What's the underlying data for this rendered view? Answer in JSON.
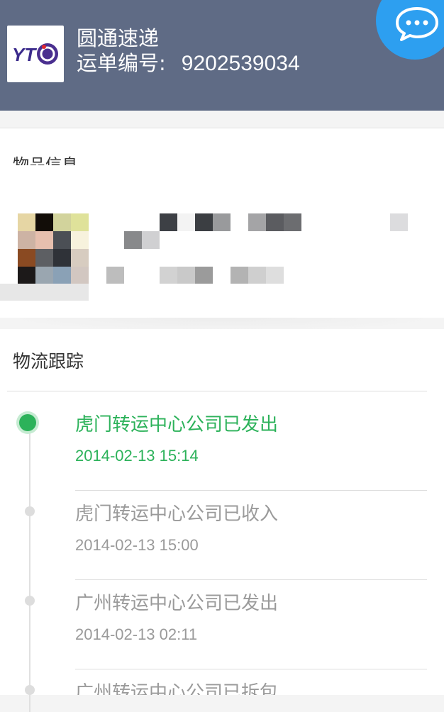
{
  "header": {
    "carrier_name": "圆通速递",
    "tracking_label": "运单编号:",
    "tracking_number": "9202539034",
    "logo_text": "YTO",
    "chat_icon": "chat-bubble-icon"
  },
  "item_info": {
    "title": "物品信息"
  },
  "logistics": {
    "title": "物流跟踪",
    "events": [
      {
        "description": "虎门转运中心公司已发出",
        "time": "2014-02-13 15:14",
        "status": "current"
      },
      {
        "description": "虎门转运中心公司已收入",
        "time": "2014-02-13 15:00",
        "status": "past"
      },
      {
        "description": "广州转运中心公司已发出",
        "time": "2014-02-13 02:11",
        "status": "past"
      },
      {
        "description": "广州转运中心公司已拆包",
        "time": "",
        "status": "past"
      }
    ]
  },
  "colors": {
    "header_bg": "#5f6b85",
    "chat_button": "#2d9ff0",
    "active_green": "#2cb25a",
    "inactive_grey": "#9a9a9a"
  }
}
